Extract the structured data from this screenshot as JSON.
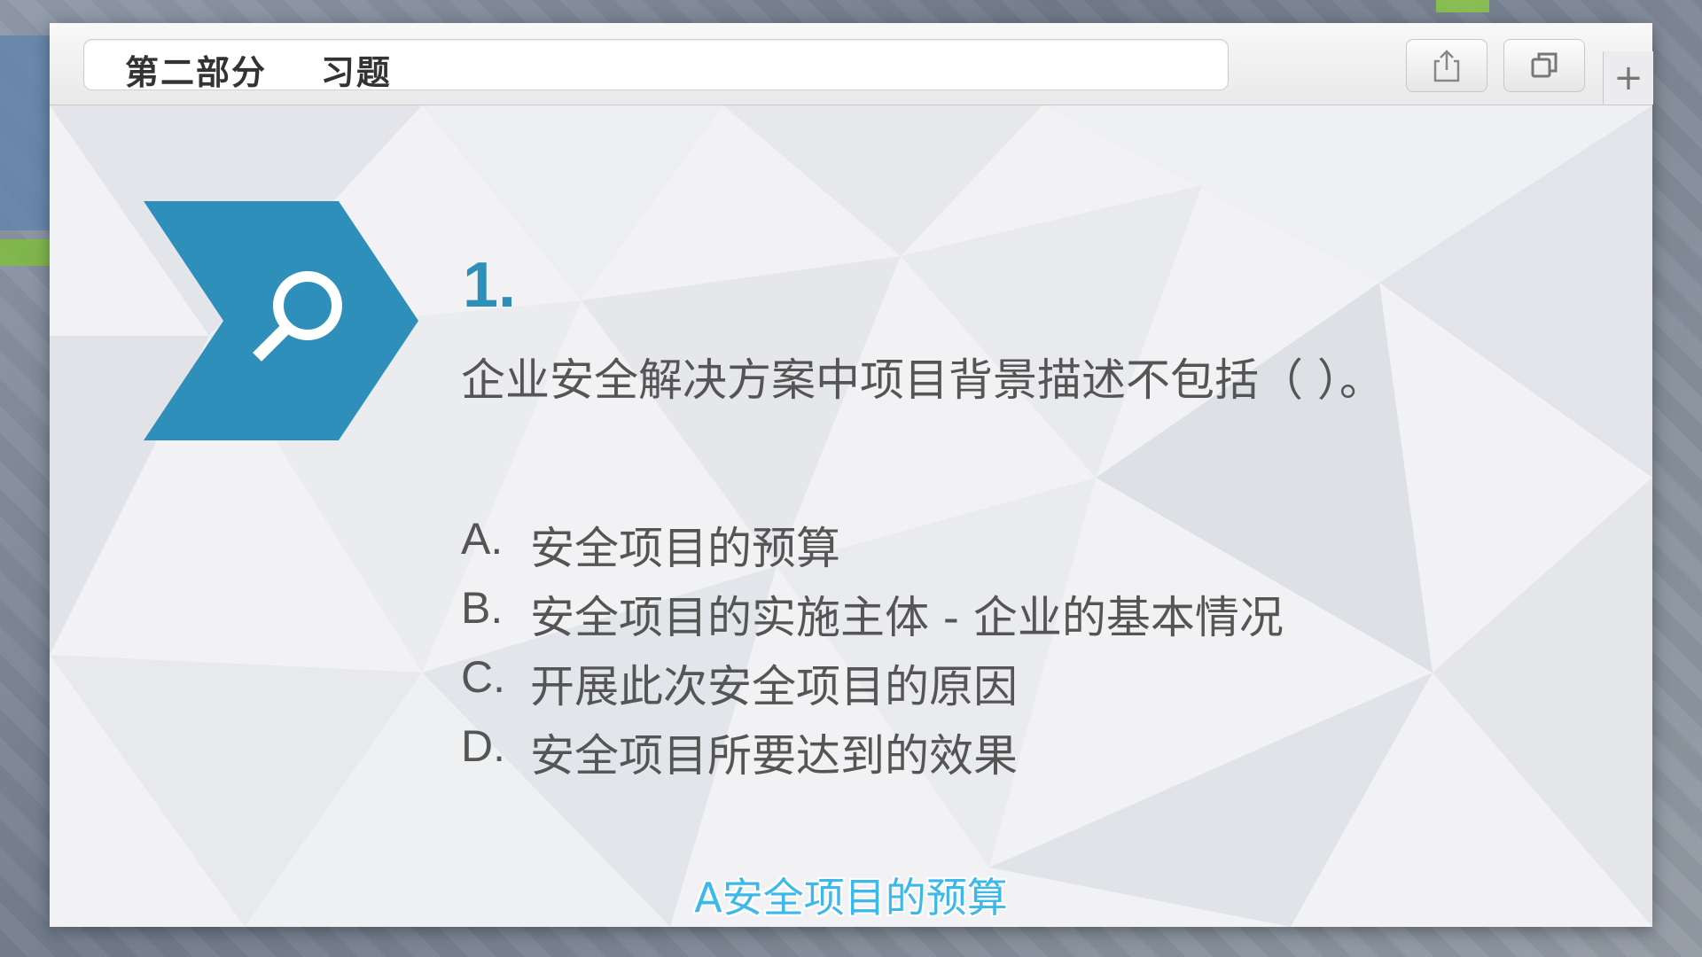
{
  "window": {
    "title": "第二部分    习题",
    "share_icon": "share-icon",
    "duplicate_icon": "duplicate-icon",
    "add_label": "+"
  },
  "slide": {
    "badge_icon": "magnifier-icon",
    "accent_color": "#2f8fbb",
    "question_number": "1.",
    "question_text": "企业安全解决方案中项目背景描述不包括（  ）。",
    "options": [
      {
        "letter": "A.",
        "text": "安全项目的预算"
      },
      {
        "letter": "B.",
        "text": "安全项目的实施主体 - 企业的基本情况"
      },
      {
        "letter": "C.",
        "text": "开展此次安全项目的原因"
      },
      {
        "letter": "D.",
        "text": "安全项目所要达到的效果"
      }
    ],
    "subtitle": "A安全项目的预算",
    "subtitle_color": "#3db8ea"
  }
}
